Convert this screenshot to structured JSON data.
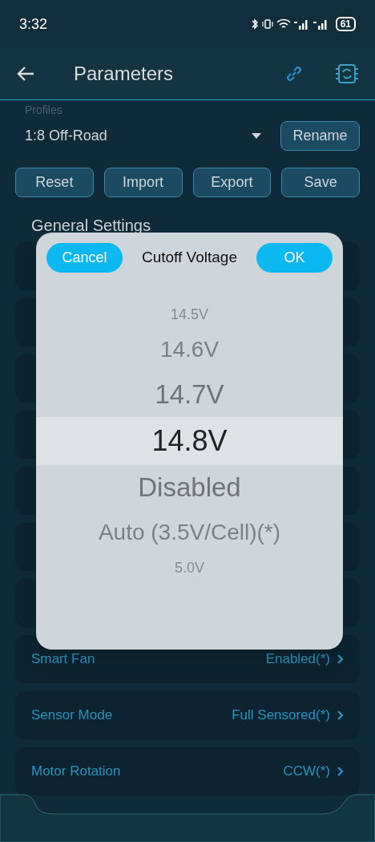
{
  "status_bar": {
    "time": "3:32",
    "battery": "61"
  },
  "header": {
    "title": "Parameters"
  },
  "profiles": {
    "label": "Profiles",
    "value": "1:8 Off-Road",
    "rename": "Rename"
  },
  "actions": [
    "Reset",
    "Import",
    "Export",
    "Save"
  ],
  "section_title": "General Settings",
  "settings": [
    {
      "label": "Smart Fan",
      "value": "Enabled(*)"
    },
    {
      "label": "Sensor Mode",
      "value": "Full Sensored(*)"
    },
    {
      "label": "Motor Rotation",
      "value": "CCW(*)"
    }
  ],
  "dialog": {
    "title": "Cutoff Voltage",
    "cancel": "Cancel",
    "ok": "OK",
    "options": [
      {
        "label": "14.5V",
        "selected": false
      },
      {
        "label": "14.6V",
        "selected": false
      },
      {
        "label": "14.7V",
        "selected": false
      },
      {
        "label": "14.8V",
        "selected": true
      },
      {
        "label": "Disabled",
        "selected": false
      },
      {
        "label": "Auto (3.5V/Cell)(*)",
        "selected": false
      },
      {
        "label": "5.0V",
        "selected": false
      }
    ]
  }
}
